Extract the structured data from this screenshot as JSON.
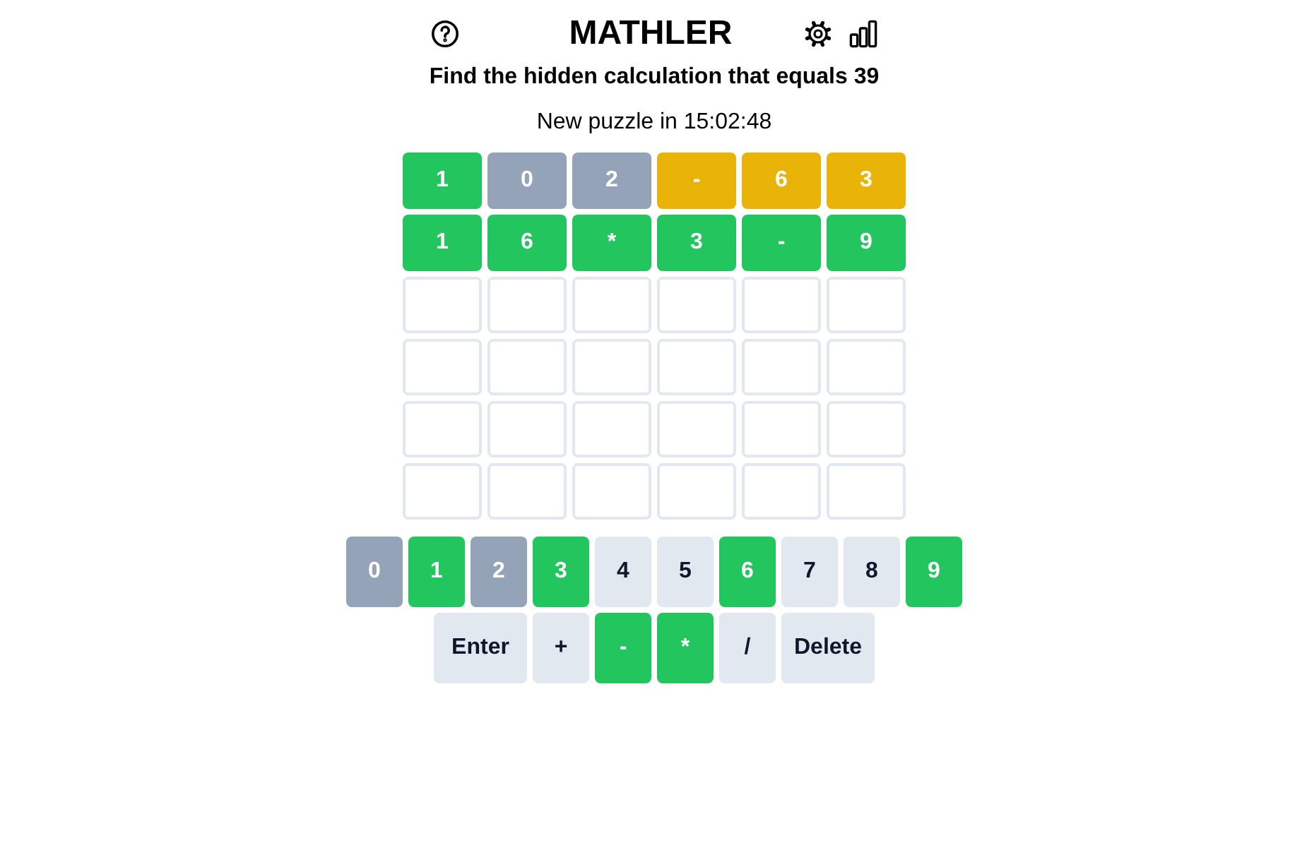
{
  "header": {
    "title": "MATHLER"
  },
  "prompt": "Find the hidden calculation that equals 39",
  "countdown": "New puzzle in 15:02:48",
  "grid": {
    "rows": [
      {
        "tiles": [
          {
            "kind": "filled",
            "value": "1",
            "color": "#22c55e"
          },
          {
            "kind": "filled",
            "value": "0",
            "color": "#94a3b8"
          },
          {
            "kind": "filled",
            "value": "2",
            "color": "#94a3b8"
          },
          {
            "kind": "filled",
            "value": "-",
            "color": "#eab308"
          },
          {
            "kind": "filled",
            "value": "6",
            "color": "#eab308"
          },
          {
            "kind": "filled",
            "value": "3",
            "color": "#eab308"
          }
        ]
      },
      {
        "tiles": [
          {
            "kind": "filled",
            "value": "1",
            "color": "#22c55e"
          },
          {
            "kind": "filled",
            "value": "6",
            "color": "#22c55e"
          },
          {
            "kind": "filled",
            "value": "*",
            "color": "#22c55e"
          },
          {
            "kind": "filled",
            "value": "3",
            "color": "#22c55e"
          },
          {
            "kind": "filled",
            "value": "-",
            "color": "#22c55e"
          },
          {
            "kind": "filled",
            "value": "9",
            "color": "#22c55e"
          }
        ]
      },
      {
        "tiles": [
          {
            "kind": "empty"
          },
          {
            "kind": "empty"
          },
          {
            "kind": "empty"
          },
          {
            "kind": "empty"
          },
          {
            "kind": "empty"
          },
          {
            "kind": "empty"
          }
        ]
      },
      {
        "tiles": [
          {
            "kind": "empty"
          },
          {
            "kind": "empty"
          },
          {
            "kind": "empty"
          },
          {
            "kind": "empty"
          },
          {
            "kind": "empty"
          },
          {
            "kind": "empty"
          }
        ]
      },
      {
        "tiles": [
          {
            "kind": "empty"
          },
          {
            "kind": "empty"
          },
          {
            "kind": "empty"
          },
          {
            "kind": "empty"
          },
          {
            "kind": "empty"
          },
          {
            "kind": "empty"
          }
        ]
      },
      {
        "tiles": [
          {
            "kind": "empty"
          },
          {
            "kind": "empty"
          },
          {
            "kind": "empty"
          },
          {
            "kind": "empty"
          },
          {
            "kind": "empty"
          },
          {
            "kind": "empty"
          }
        ]
      }
    ]
  },
  "keyboard": {
    "rows": [
      {
        "keys": [
          {
            "label": "0",
            "kind": "char",
            "color": "#94a3b8"
          },
          {
            "label": "1",
            "kind": "char",
            "color": "#22c55e"
          },
          {
            "label": "2",
            "kind": "char",
            "color": "#94a3b8"
          },
          {
            "label": "3",
            "kind": "char",
            "color": "#22c55e"
          },
          {
            "label": "4",
            "kind": "char",
            "color": "#e2e8f0"
          },
          {
            "label": "5",
            "kind": "char",
            "color": "#e2e8f0"
          },
          {
            "label": "6",
            "kind": "char",
            "color": "#22c55e"
          },
          {
            "label": "7",
            "kind": "char",
            "color": "#e2e8f0"
          },
          {
            "label": "8",
            "kind": "char",
            "color": "#e2e8f0"
          },
          {
            "label": "9",
            "kind": "char",
            "color": "#22c55e"
          }
        ]
      },
      {
        "keys": [
          {
            "label": "Enter",
            "kind": "action",
            "color": "#e2e8f0"
          },
          {
            "label": "+",
            "kind": "char",
            "color": "#e2e8f0"
          },
          {
            "label": "-",
            "kind": "char",
            "color": "#22c55e"
          },
          {
            "label": "*",
            "kind": "char",
            "color": "#22c55e"
          },
          {
            "label": "/",
            "kind": "char",
            "color": "#e2e8f0"
          },
          {
            "label": "Delete",
            "kind": "action",
            "color": "#e2e8f0"
          }
        ]
      }
    ]
  }
}
